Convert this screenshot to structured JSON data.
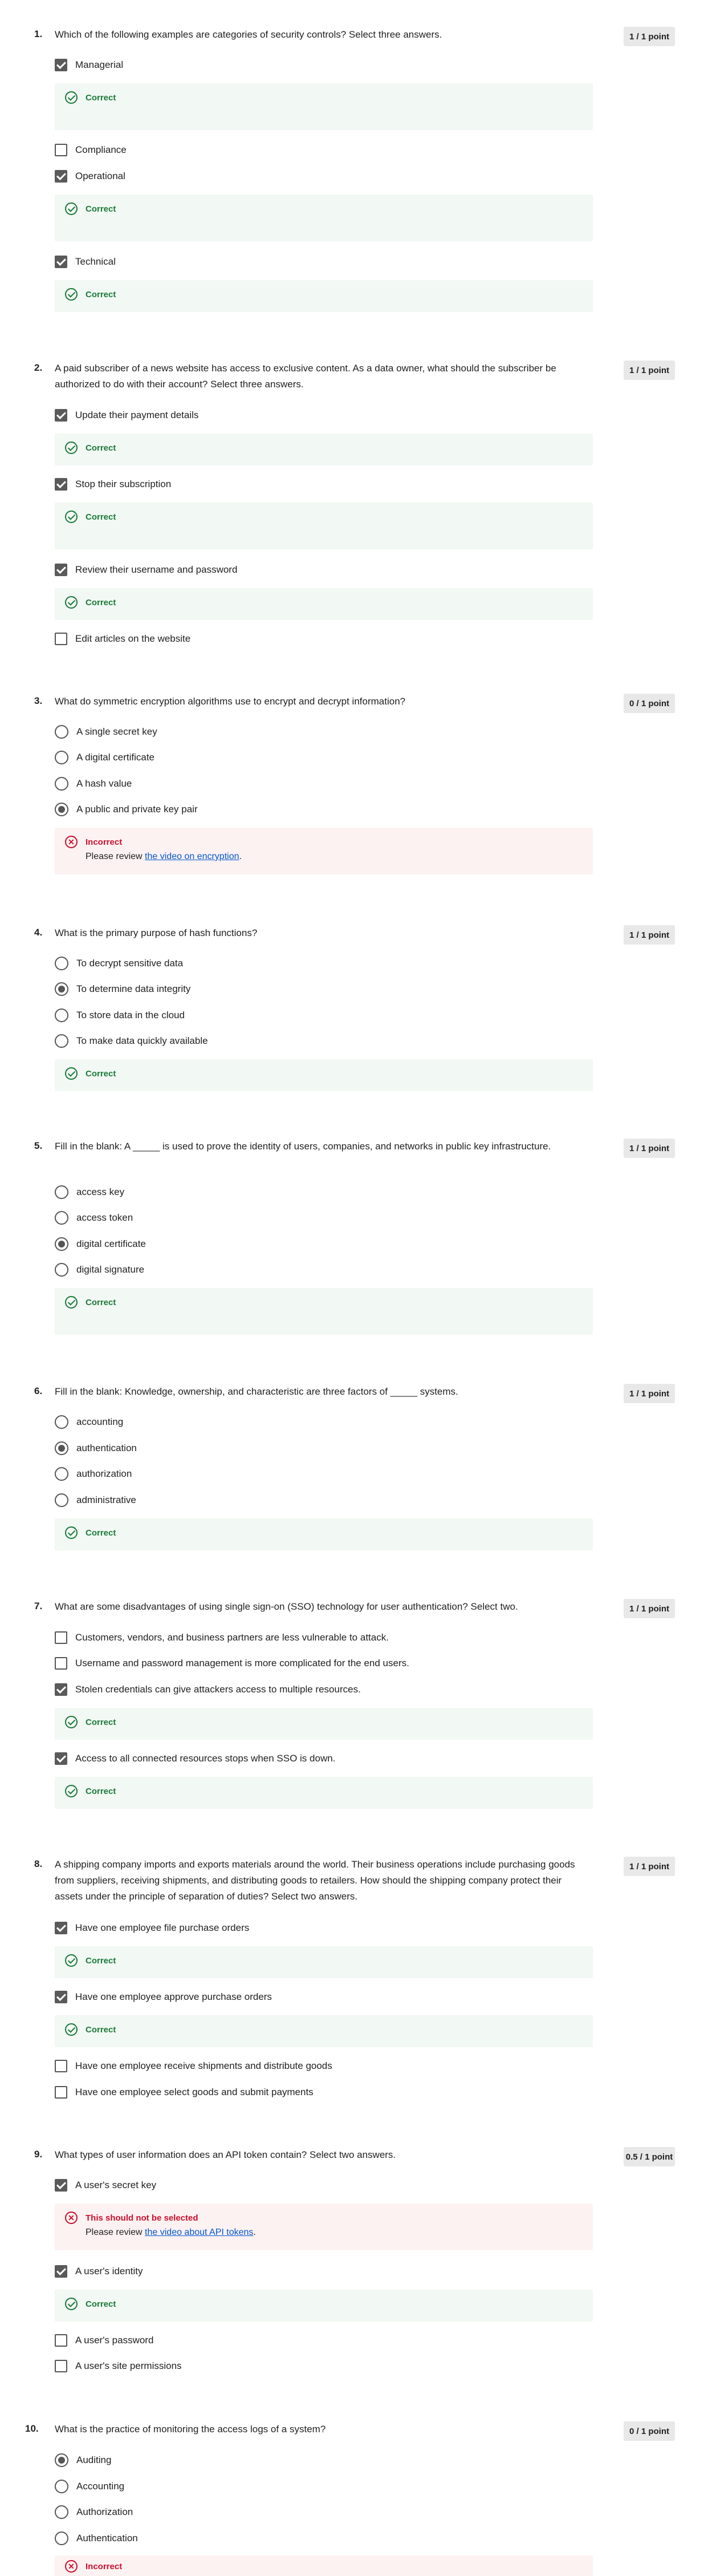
{
  "colors": {
    "correct": "#1a7a3a",
    "incorrect": "#c8102e",
    "link": "#0056d2",
    "points_bg": "#e8e8e8"
  },
  "feedback_labels": {
    "correct": "Correct",
    "incorrect": "Incorrect",
    "not_selected": "This should not be selected",
    "review_prefix": "Please review "
  },
  "questions": [
    {
      "num": "1.",
      "text": "Which of the following examples are categories of security controls? Select three answers.",
      "points": "1 / 1 point",
      "options": [
        "Managerial",
        "Compliance",
        "Operational",
        "Technical"
      ]
    },
    {
      "num": "2.",
      "text": "A paid subscriber of a news website has access to exclusive content. As a data owner, what should the subscriber be authorized to do with their account? Select three answers.",
      "points": "1 / 1 point",
      "options": [
        "Update their payment details",
        "Stop their subscription",
        "Review their username and password",
        "Edit articles on the website"
      ]
    },
    {
      "num": "3.",
      "text": "What do symmetric encryption algorithms use to encrypt and decrypt information?",
      "points": "0 / 1 point",
      "options": [
        "A single secret key",
        "A digital certificate",
        "A hash value",
        "A public and private key pair"
      ],
      "review_link": "the video on encryption"
    },
    {
      "num": "4.",
      "text": "What is the primary purpose of hash functions?",
      "points": "1 / 1 point",
      "options": [
        "To decrypt sensitive data",
        "To determine data integrity",
        "To store data in the cloud",
        "To make data quickly available"
      ]
    },
    {
      "num": "5.",
      "text": "Fill in the blank: A _____ is used to prove the identity of users, companies, and networks in public key infrastructure.",
      "points": "1 / 1 point",
      "options": [
        "access key",
        "access token",
        "digital certificate",
        "digital signature"
      ]
    },
    {
      "num": "6.",
      "text": "Fill in the blank: Knowledge, ownership, and characteristic are three factors of _____ systems.",
      "points": "1 / 1 point",
      "options": [
        "accounting",
        "authentication",
        "authorization",
        "administrative"
      ]
    },
    {
      "num": "7.",
      "text": "What are some disadvantages of using single sign-on (SSO) technology for user authentication? Select two.",
      "points": "1 / 1 point",
      "options": [
        "Customers, vendors, and business partners are less vulnerable to attack.",
        "Username and password management is more complicated for the end users.",
        "Stolen credentials can give attackers access to multiple resources.",
        "Access to all connected resources stops when SSO is down."
      ]
    },
    {
      "num": "8.",
      "text": "A shipping company imports and exports materials around the world. Their business operations include purchasing goods from suppliers, receiving shipments, and distributing goods to retailers. How should the shipping company protect their assets under the principle of separation of duties? Select two answers.",
      "points": "1 / 1 point",
      "options": [
        "Have one employee file purchase orders",
        "Have one employee approve purchase orders",
        "Have one employee receive shipments and distribute goods",
        "Have one employee select goods and submit payments"
      ]
    },
    {
      "num": "9.",
      "text": "What types of user information does an API token contain? Select two answers.",
      "points": "0.5 / 1 point",
      "options": [
        "A user's secret key",
        "A user's identity",
        "A user's password",
        "A user's site permissions"
      ],
      "review_link": "the video about API tokens"
    },
    {
      "num": "10.",
      "text": "What is the practice of monitoring the access logs of a system?",
      "points": "0 / 1 point",
      "options": [
        "Auditing",
        "Accounting",
        "Authorization",
        "Authentication"
      ]
    }
  ]
}
